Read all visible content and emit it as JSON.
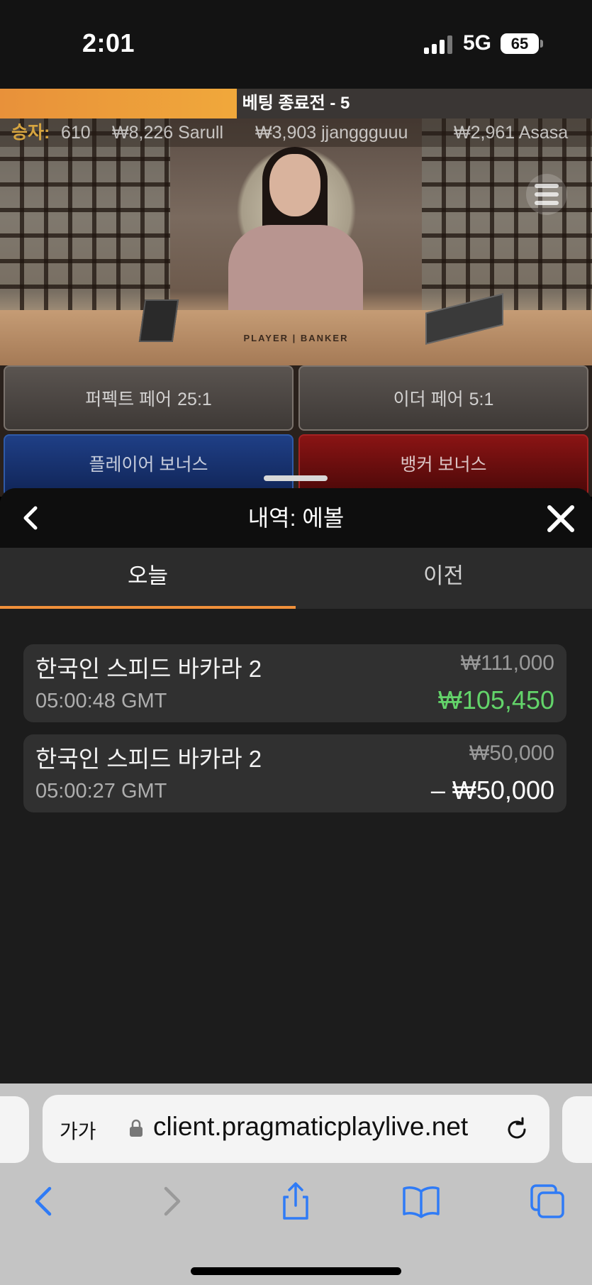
{
  "status_bar": {
    "time": "2:01",
    "network": "5G",
    "battery": "65"
  },
  "game": {
    "timer_text": "베팅 종료전 - 5",
    "timer_fraction": 0.4,
    "winners_label": "승자:",
    "winners": [
      "610",
      "₩8,226 Sarull",
      "₩3,903 jjanggguuu",
      "₩2,961 Asasa"
    ],
    "table_label": "PLAYER | BANKER",
    "bets": {
      "perfect_pair": {
        "label": "퍼펙트 페어",
        "odds": "25:1"
      },
      "either_pair": {
        "label": "이더 페어",
        "odds": "5:1"
      },
      "player_bonus": {
        "label": "플레이어 보너스"
      },
      "banker_bonus": {
        "label": "뱅커 보너스"
      }
    }
  },
  "history": {
    "title": "내역: 에볼",
    "tabs": [
      {
        "label": "오늘",
        "active": true
      },
      {
        "label": "이전",
        "active": false
      }
    ],
    "items": [
      {
        "game": "한국인 스피드 바카라 2",
        "time": "05:00:48 GMT",
        "stake": "₩111,000",
        "result": "₩105,450",
        "result_type": "win"
      },
      {
        "game": "한국인 스피드 바카라 2",
        "time": "05:00:27 GMT",
        "stake": "₩50,000",
        "result": "– ₩50,000",
        "result_type": "loss"
      }
    ]
  },
  "browser": {
    "text_size_label": "가가",
    "url": "client.pragmaticplaylive.net"
  },
  "colors": {
    "accent_orange": "#f0903a",
    "win_green": "#63d46a",
    "ios_blue": "#2f7bf6"
  }
}
